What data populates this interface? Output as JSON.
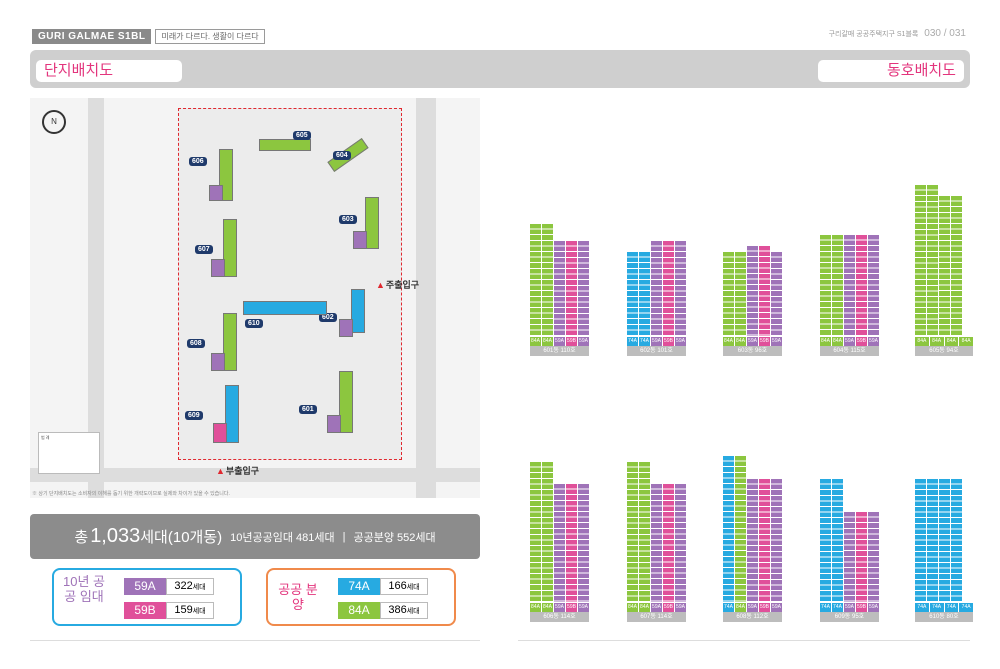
{
  "header": {
    "brand": "GURI GALMAE S1BL",
    "slogan": "미래가 다르다. 생활이 다르다",
    "right_text": "구리갈매 공공주택지구 S1블록 ",
    "page_numbers": "030 / 031"
  },
  "section_left_title": "단지배치도",
  "section_right_title": "동호배치도",
  "sitemap": {
    "compass": "N",
    "gates": {
      "main": "주출입구",
      "sub": "부출입구"
    },
    "buildings": [
      "605",
      "604",
      "606",
      "603",
      "607",
      "602",
      "610",
      "608",
      "601",
      "609"
    ],
    "legend_title": "범 례"
  },
  "note": "※ 상기 단지배치도는 소비자의 이해를 돕기 위한 개략도이므로 실제와 차이가 있을 수 있습니다.",
  "total": {
    "prefix": "총",
    "number": "1,033",
    "unit": "세대(10개동)",
    "rental": "10년공공임대 481세대",
    "sep": "|",
    "sale": "공공분양 552세대"
  },
  "box_rental": {
    "label": "10년 공공 임대",
    "rows": [
      {
        "type": "59A",
        "count": "322",
        "unit": "세대",
        "color": "#9f73b8"
      },
      {
        "type": "59B",
        "count": "159",
        "unit": "세대",
        "color": "#e0509a"
      }
    ]
  },
  "box_sale": {
    "label": "공공 분양",
    "rows": [
      {
        "type": "74A",
        "count": "166",
        "unit": "세대",
        "color": "#27aae1"
      },
      {
        "type": "84A",
        "count": "386",
        "unit": "세대",
        "color": "#8cc63f"
      }
    ]
  },
  "dong_blocks": [
    {
      "label": "601동 110호",
      "feet": [
        "84A",
        "84A",
        "59A",
        "59B",
        "59A"
      ]
    },
    {
      "label": "602동 101호",
      "feet": [
        "74A",
        "74A",
        "59A",
        "59B",
        "59A"
      ]
    },
    {
      "label": "603동 96호",
      "feet": [
        "84A",
        "84A",
        "59A",
        "59B",
        "59A"
      ]
    },
    {
      "label": "604동 115호",
      "feet": [
        "84A",
        "84A",
        "59A",
        "59B",
        "59A"
      ]
    },
    {
      "label": "605동 94호",
      "feet": [
        "84A",
        "84A",
        "84A",
        "84A"
      ]
    },
    {
      "label": "606동 114호",
      "feet": [
        "84A",
        "84A",
        "59A",
        "59B",
        "59A"
      ]
    },
    {
      "label": "607동 114호",
      "feet": [
        "84A",
        "84A",
        "59A",
        "59B",
        "59A"
      ]
    },
    {
      "label": "608동 112호",
      "feet": [
        "74A",
        "84A",
        "59A",
        "59B",
        "59A"
      ]
    },
    {
      "label": "609동 95호",
      "feet": [
        "74A",
        "74A",
        "59A",
        "59B",
        "59A"
      ]
    },
    {
      "label": "610동 80호",
      "feet": [
        "74A",
        "74A",
        "74A",
        "74A"
      ]
    }
  ],
  "colors": {
    "green": "#8cc63f",
    "purple": "#9f73b8",
    "pink": "#e0509a",
    "blue": "#27aae1",
    "accent": "#e3357d"
  }
}
